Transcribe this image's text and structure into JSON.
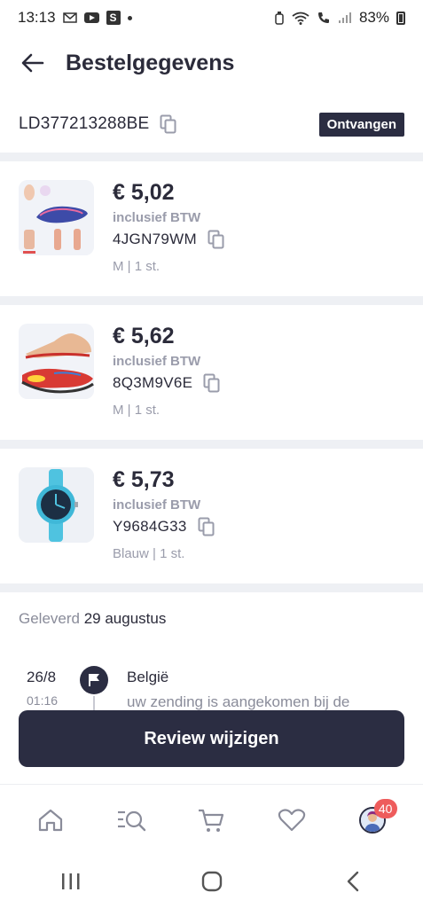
{
  "status_bar": {
    "time": "13:13",
    "battery": "83%",
    "icons": [
      "mail-icon",
      "youtube-icon",
      "s-app-icon",
      "dot-icon",
      "alarm-icon",
      "wifi-icon",
      "call-icon",
      "signal-icon",
      "battery-icon"
    ]
  },
  "header": {
    "title": "Bestelgegevens",
    "back_icon": "arrow-left-icon"
  },
  "order": {
    "number": "LD377213288BE",
    "status": "Ontvangen"
  },
  "products": [
    {
      "price": "€ 5,02",
      "vat": "inclusief BTW",
      "sku": "4JGN79WM",
      "variant": "M | 1 st.",
      "image": "insole-product-image"
    },
    {
      "price": "€ 5,62",
      "vat": "inclusief BTW",
      "sku": "8Q3M9V6E",
      "variant": "M | 1 st.",
      "image": "arch-support-insole-image"
    },
    {
      "price": "€ 5,73",
      "vat": "inclusief BTW",
      "sku": "Y9684G33",
      "variant": "Blauw | 1 st.",
      "image": "blue-watch-image"
    }
  ],
  "delivery": {
    "label": "Geleverd",
    "date": "29 augustus"
  },
  "timeline": {
    "day": "26/8",
    "time": "01:16",
    "place": "België",
    "description": "uw zending is aangekomen bij de"
  },
  "review_button": "Review wijzigen",
  "bottom_nav": {
    "items": [
      "home-icon",
      "search-list-icon",
      "cart-icon",
      "heart-icon",
      "avatar"
    ],
    "badge": "40"
  },
  "system_nav": [
    "recent-apps-icon",
    "home-button-icon",
    "back-icon"
  ],
  "colors": {
    "primary": "#2b2d42",
    "muted": "#9a9cab",
    "badge": "#ee5c5c",
    "divider": "#eef0f4"
  }
}
